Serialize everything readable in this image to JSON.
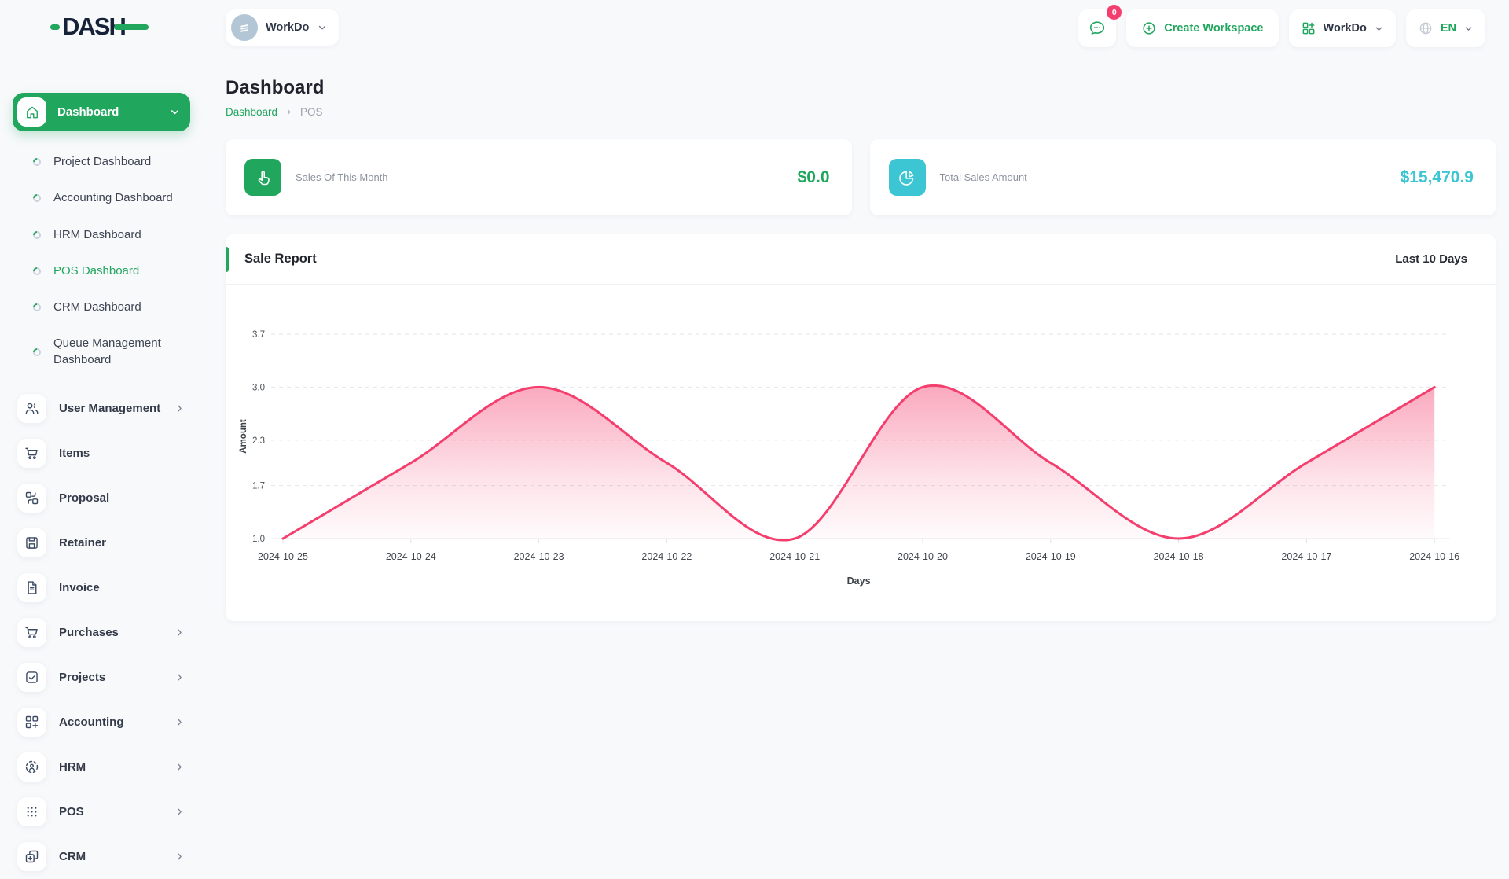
{
  "app": {
    "logo_text": "DASH"
  },
  "colors": {
    "green": "#21a65e",
    "pink": "#f43f6e",
    "cyan": "#3cc5d2",
    "badge_pink": "#f43f6e"
  },
  "topbar": {
    "workspace": {
      "name": "WorkDo"
    },
    "chat": {
      "badge": "0"
    },
    "create_workspace_label": "Create Workspace",
    "workdo_dropdown_label": "WorkDo",
    "language": "EN"
  },
  "sidebar": {
    "dashboard": {
      "label": "Dashboard"
    },
    "dashboard_children": [
      {
        "label": "Project Dashboard",
        "active": false
      },
      {
        "label": "Accounting Dashboard",
        "active": false
      },
      {
        "label": "HRM Dashboard",
        "active": false
      },
      {
        "label": "POS Dashboard",
        "active": true
      },
      {
        "label": "CRM Dashboard",
        "active": false
      },
      {
        "label": "Queue Management Dashboard",
        "active": false
      }
    ],
    "items": [
      {
        "label": "User Management",
        "icon": "users-icon",
        "chevron": true
      },
      {
        "label": "Items",
        "icon": "cart-icon",
        "chevron": false
      },
      {
        "label": "Proposal",
        "icon": "proposal-icon",
        "chevron": false
      },
      {
        "label": "Retainer",
        "icon": "retainer-icon",
        "chevron": false
      },
      {
        "label": "Invoice",
        "icon": "invoice-icon",
        "chevron": false
      },
      {
        "label": "Purchases",
        "icon": "cart-icon",
        "chevron": true
      },
      {
        "label": "Projects",
        "icon": "check-square-icon",
        "chevron": true
      },
      {
        "label": "Accounting",
        "icon": "grid-plus-icon",
        "chevron": true
      },
      {
        "label": "HRM",
        "icon": "hrm-icon",
        "chevron": true
      },
      {
        "label": "POS",
        "icon": "dots-grid-icon",
        "chevron": true
      },
      {
        "label": "CRM",
        "icon": "crm-icon",
        "chevron": true
      }
    ]
  },
  "page": {
    "title": "Dashboard",
    "breadcrumb": [
      "Dashboard",
      "POS"
    ]
  },
  "cards": [
    {
      "label": "Sales Of This Month",
      "value": "$0.0",
      "accent": "#21a65e",
      "icon": "hand-pointer-icon"
    },
    {
      "label": "Total Sales Amount",
      "value": "$15,470.9",
      "accent": "#3cc5d2",
      "icon": "pie-chart-icon"
    }
  ],
  "chart_card": {
    "title": "Sale Report",
    "range_label": "Last 10 Days"
  },
  "chart_data": {
    "type": "area",
    "title": "Sale Report",
    "x": [
      "2024-10-25",
      "2024-10-24",
      "2024-10-23",
      "2024-10-22",
      "2024-10-21",
      "2024-10-20",
      "2024-10-19",
      "2024-10-18",
      "2024-10-17",
      "2024-10-16"
    ],
    "series": [
      {
        "name": "Amount",
        "values": [
          1.0,
          2.0,
          3.0,
          2.0,
          1.0,
          3.0,
          2.0,
          1.0,
          2.0,
          3.0
        ]
      }
    ],
    "xlabel": "Days",
    "ylabel": "Amount",
    "yticks": [
      1.0,
      1.7,
      2.3,
      3.0,
      3.7
    ],
    "ylim": [
      1.0,
      3.7
    ],
    "line_color": "#f43f6e",
    "grid": true,
    "legend": false,
    "curve": "smooth"
  }
}
